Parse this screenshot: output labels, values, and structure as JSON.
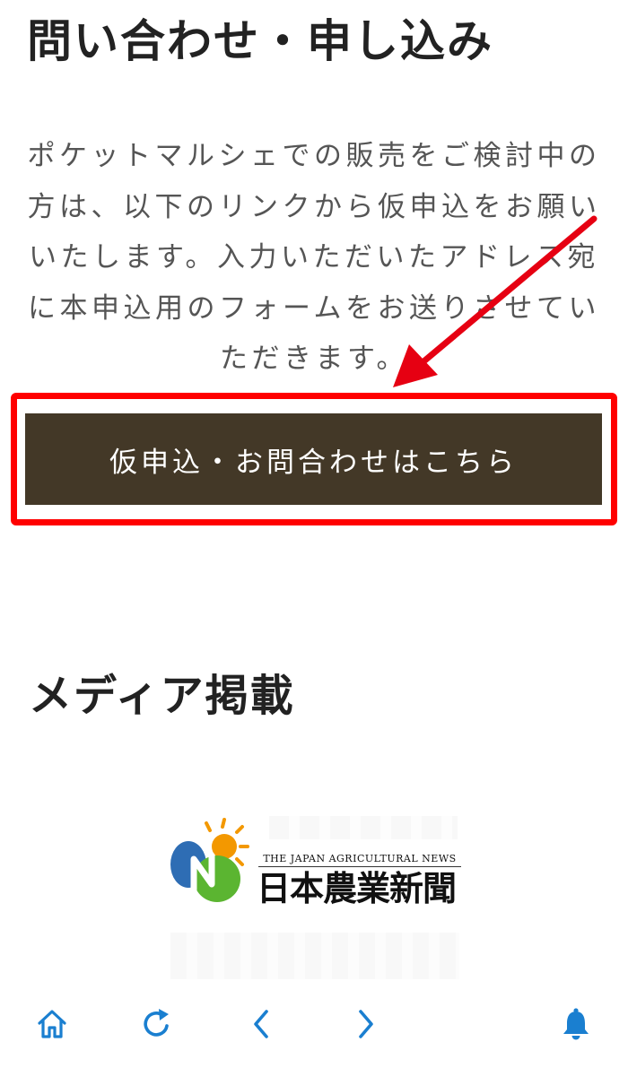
{
  "inquiry": {
    "title": "問い合わせ・申し込み",
    "description": "ポケットマルシェでの販売をご検討中の方は、以下のリンクから仮申込をお願いいたします。入力いただいたアドレス宛に本申込用のフォームをお送りさせていただきます。",
    "button_label": "仮申込・お問合わせはこちら",
    "highlight_color": "#ff0000",
    "button_color": "#433827"
  },
  "media": {
    "title": "メディア掲載",
    "logo": {
      "en_text": "THE JAPAN AGRICULTURAL NEWS",
      "ja_text": "日本農業新聞"
    }
  },
  "browser_nav": {
    "icons": [
      "home-icon",
      "reload-icon",
      "back-icon",
      "forward-icon",
      "bell-icon"
    ],
    "accent": "#1a7fd0"
  }
}
